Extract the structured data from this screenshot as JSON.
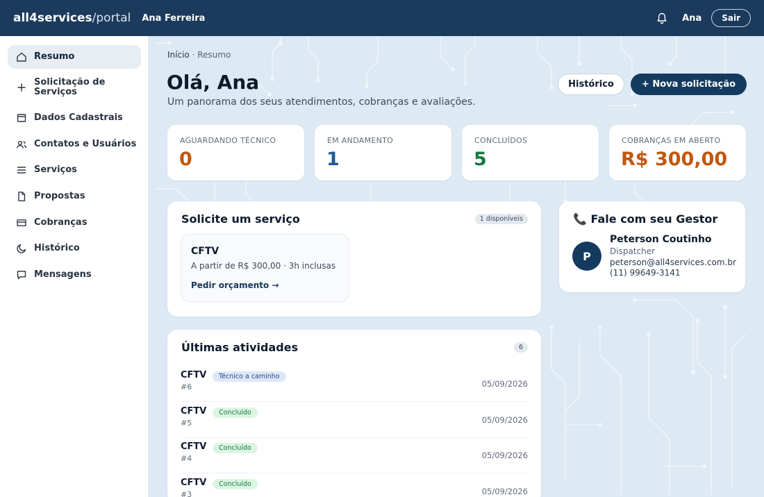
{
  "brand": {
    "name": "all4services",
    "suffix": "/portal"
  },
  "header": {
    "user_name": "Ana Ferreira",
    "short_name": "Ana",
    "logout_label": "Sair",
    "bell_icon": "bell-icon"
  },
  "sidebar": {
    "items": [
      {
        "label": "Resumo",
        "icon": "home-icon"
      },
      {
        "label": "Solicitação de Serviços",
        "icon": "plus-icon"
      },
      {
        "label": "Dados Cadastrais",
        "icon": "window-icon"
      },
      {
        "label": "Contatos e Usuários",
        "icon": "users-icon"
      },
      {
        "label": "Serviços",
        "icon": "menu-icon"
      },
      {
        "label": "Propostas",
        "icon": "document-icon"
      },
      {
        "label": "Cobranças",
        "icon": "card-icon"
      },
      {
        "label": "Histórico",
        "icon": "history-icon"
      },
      {
        "label": "Mensagens",
        "icon": "message-icon"
      }
    ]
  },
  "breadcrumb": {
    "home": "Início",
    "separator": " · ",
    "current": "Resumo"
  },
  "page": {
    "title": "Olá, Ana",
    "subtitle": "Um panorama dos seus atendimentos, cobranças e avaliações.",
    "history_button": "Histórico",
    "new_request_button": "+ Nova solicitação"
  },
  "stats": [
    {
      "label": "AGUARDANDO TÉCNICO",
      "value": "0",
      "color": "#c2570c"
    },
    {
      "label": "EM ANDAMENTO",
      "value": "1",
      "color": "#1f5a96"
    },
    {
      "label": "CONCLUÍDOS",
      "value": "5",
      "color": "#167a3c"
    },
    {
      "label": "COBRANÇAS EM ABERTO",
      "value": "R$ 300,00",
      "color": "#c2570c"
    }
  ],
  "request": {
    "title": "Solicite um serviço",
    "badge": "1 disponíveis",
    "service": {
      "name": "CFTV",
      "description": "A partir de R$ 300,00 · 3h inclusas",
      "link": "Pedir orçamento →"
    }
  },
  "manager": {
    "title": "📞 Fale com seu Gestor",
    "initial": "P",
    "name": "Peterson Coutinho",
    "role": "Dispatcher",
    "email": "peterson@all4services.com.br",
    "phone": "(11) 99649-3141"
  },
  "activities": {
    "title": "Últimas atividades",
    "count": "6",
    "items": [
      {
        "name": "CFTV",
        "id": "#6",
        "status": "Técnico a caminho",
        "status_bg": "#dde7f7",
        "status_color": "#1f4a86",
        "date": "05/09/2026"
      },
      {
        "name": "CFTV",
        "id": "#5",
        "status": "Concluído",
        "status_bg": "#dcf5e3",
        "status_color": "#167a3c",
        "date": "05/09/2026"
      },
      {
        "name": "CFTV",
        "id": "#4",
        "status": "Concluído",
        "status_bg": "#dcf5e3",
        "status_color": "#167a3c",
        "date": "05/09/2026"
      },
      {
        "name": "CFTV",
        "id": "#3",
        "status": "Concluído",
        "status_bg": "#dcf5e3",
        "status_color": "#167a3c",
        "date": "05/09/2026"
      }
    ]
  }
}
